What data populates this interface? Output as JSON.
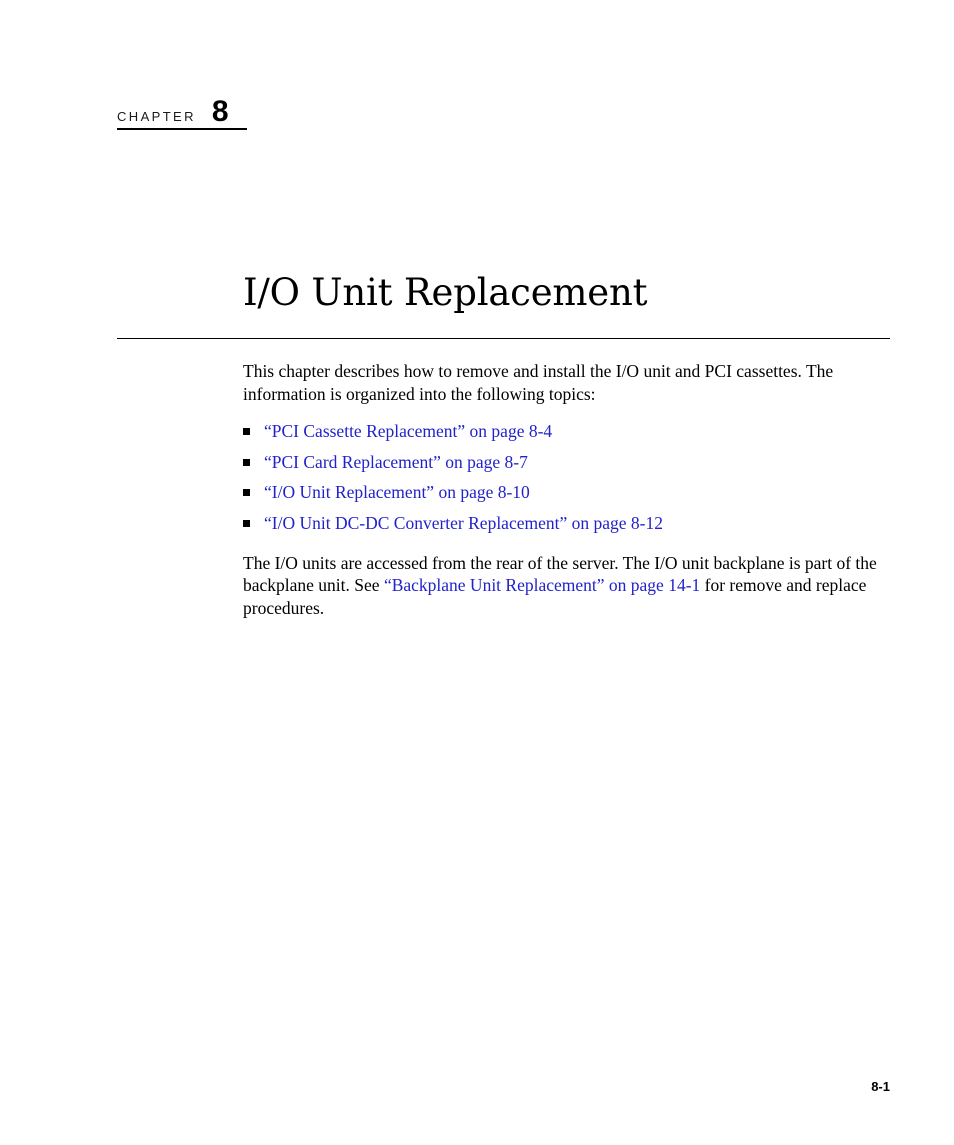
{
  "chapter": {
    "label": "CHAPTER",
    "number": "8",
    "title": "I/O Unit Replacement"
  },
  "intro": {
    "text": "This chapter describes how to remove and install the I/O unit and PCI cassettes. The information is organized into the following topics:"
  },
  "topics": [
    {
      "bullet": "square-bullet",
      "link_text": "“PCI Cassette Replacement” on page 8-4"
    },
    {
      "bullet": "square-bullet",
      "link_text": "“PCI Card Replacement” on page 8-7"
    },
    {
      "bullet": "square-bullet",
      "link_text": "“I/O Unit Replacement” on page 8-10"
    },
    {
      "bullet": "square-bullet",
      "link_text": "“I/O Unit DC-DC Converter Replacement” on page 8-12"
    }
  ],
  "closing": {
    "lead": "The I/O units are accessed from the rear of the server. The I/O unit backplane is part of the backplane unit. See ",
    "link_text": "“Backplane Unit Replacement” on page 14-1",
    "tail": " for remove and replace procedures."
  },
  "footer": {
    "page_number": "8-1"
  },
  "colors": {
    "link": "#2222cc",
    "text": "#000000",
    "background": "#ffffff"
  }
}
